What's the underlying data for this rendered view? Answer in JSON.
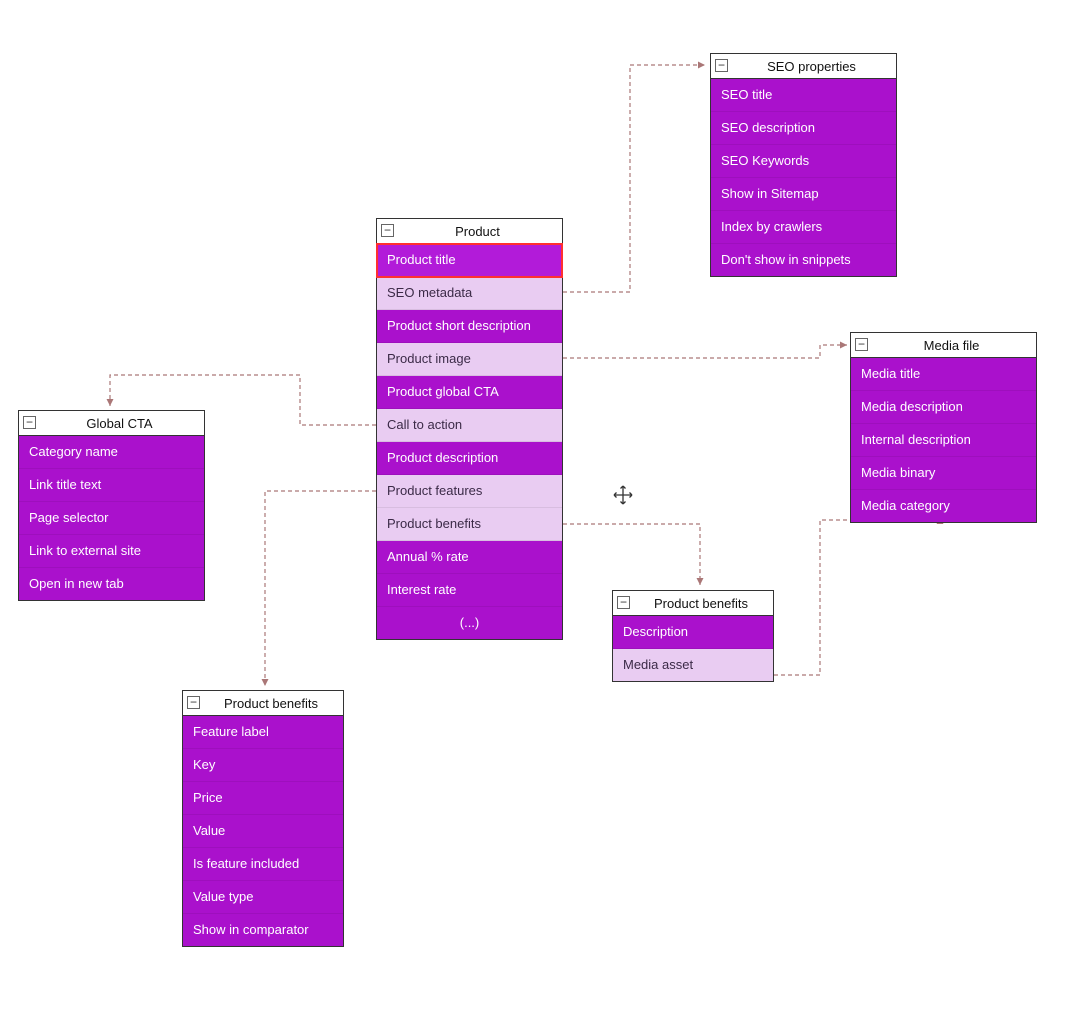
{
  "entities": {
    "product": {
      "title": "Product",
      "rows": [
        {
          "label": "Product title",
          "style": "selected"
        },
        {
          "label": "SEO metadata",
          "style": "light"
        },
        {
          "label": "Product short description",
          "style": "normal"
        },
        {
          "label": "Product image",
          "style": "light"
        },
        {
          "label": "Product global CTA",
          "style": "normal"
        },
        {
          "label": "Call to action",
          "style": "light"
        },
        {
          "label": "Product description",
          "style": "normal"
        },
        {
          "label": "Product features",
          "style": "light"
        },
        {
          "label": "Product benefits",
          "style": "light"
        },
        {
          "label": "Annual % rate",
          "style": "normal"
        },
        {
          "label": "Interest rate",
          "style": "normal"
        },
        {
          "label": "(...)",
          "style": "more"
        }
      ]
    },
    "seo": {
      "title": "SEO properties",
      "rows": [
        {
          "label": "SEO title",
          "style": "normal"
        },
        {
          "label": "SEO description",
          "style": "normal"
        },
        {
          "label": "SEO Keywords",
          "style": "normal"
        },
        {
          "label": "Show in Sitemap",
          "style": "normal"
        },
        {
          "label": "Index by crawlers",
          "style": "normal"
        },
        {
          "label": "Don't show in snippets",
          "style": "normal"
        }
      ]
    },
    "media": {
      "title": "Media file",
      "rows": [
        {
          "label": "Media title",
          "style": "normal"
        },
        {
          "label": "Media description",
          "style": "normal"
        },
        {
          "label": "Internal description",
          "style": "normal"
        },
        {
          "label": "Media binary",
          "style": "normal"
        },
        {
          "label": "Media category",
          "style": "normal"
        }
      ]
    },
    "benefits_small": {
      "title": "Product benefits",
      "rows": [
        {
          "label": "Description",
          "style": "normal"
        },
        {
          "label": "Media asset",
          "style": "light"
        }
      ]
    },
    "global_cta": {
      "title": "Global CTA",
      "rows": [
        {
          "label": "Category name",
          "style": "normal"
        },
        {
          "label": "Link title text",
          "style": "normal"
        },
        {
          "label": "Page selector",
          "style": "normal"
        },
        {
          "label": "Link to external site",
          "style": "normal"
        },
        {
          "label": "Open in new tab",
          "style": "normal"
        }
      ]
    },
    "benefits_large": {
      "title": "Product benefits",
      "rows": [
        {
          "label": "Feature label",
          "style": "normal"
        },
        {
          "label": "Key",
          "style": "normal"
        },
        {
          "label": "Price",
          "style": "normal"
        },
        {
          "label": "Value",
          "style": "normal"
        },
        {
          "label": "Is feature included",
          "style": "normal"
        },
        {
          "label": "Value type",
          "style": "normal"
        },
        {
          "label": "Show in comparator",
          "style": "normal"
        }
      ]
    }
  },
  "collapse_glyph": "−"
}
